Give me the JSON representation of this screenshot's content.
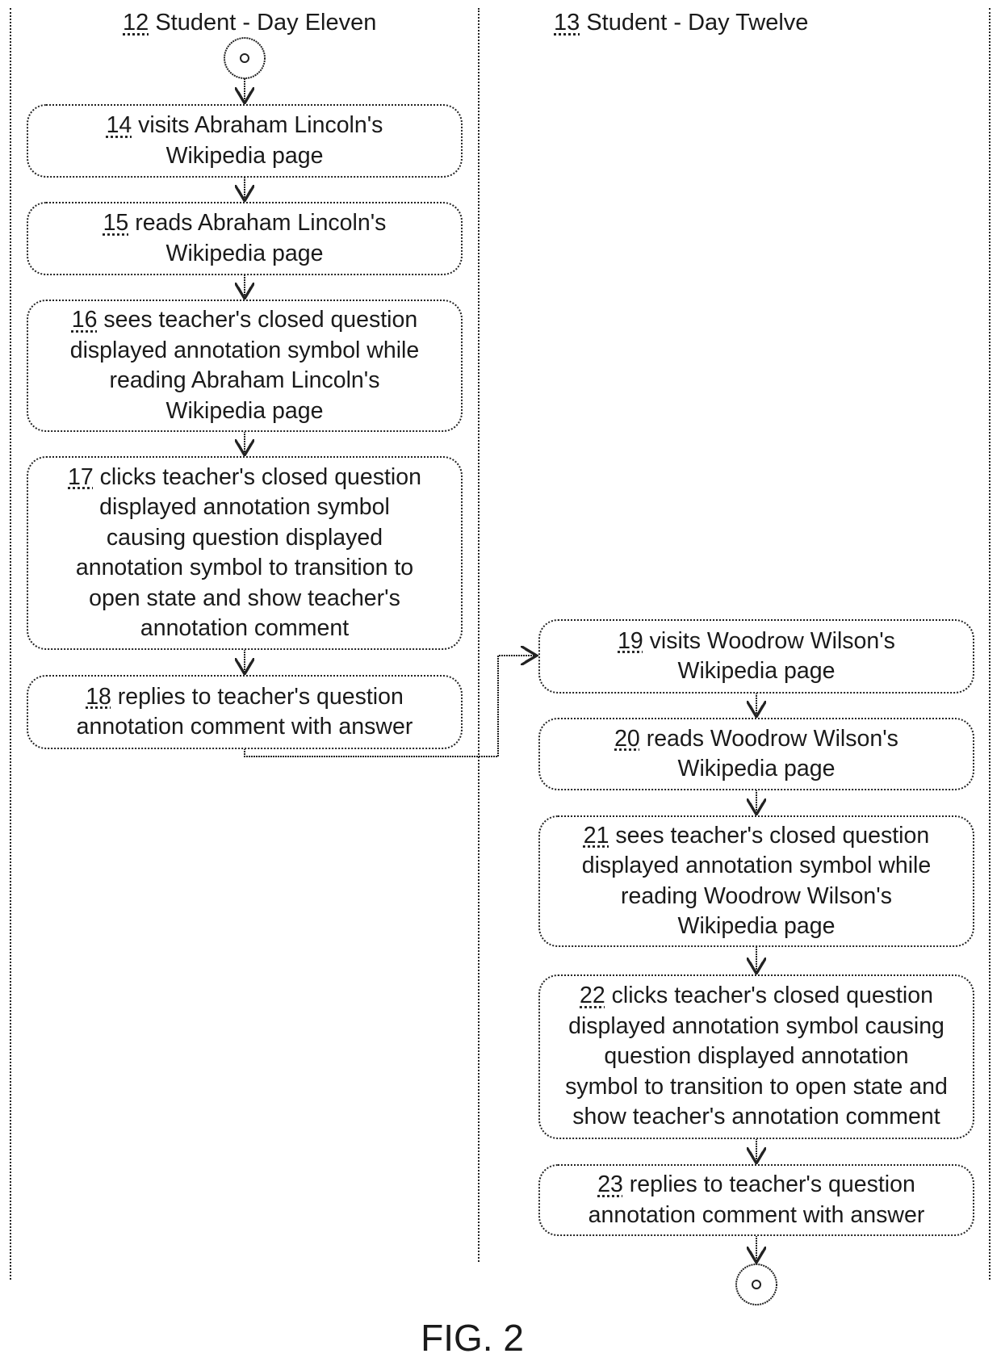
{
  "lanes": [
    {
      "ref": "12",
      "title": "Student - Day Eleven"
    },
    {
      "ref": "13",
      "title": "Student - Day Twelve"
    }
  ],
  "steps": [
    {
      "ref": "14",
      "text": " visits Abraham Lincoln's\nWikipedia page",
      "lane": 0
    },
    {
      "ref": "15",
      "text": " reads Abraham Lincoln's\nWikipedia page",
      "lane": 0
    },
    {
      "ref": "16",
      "text": " sees teacher's closed question\ndisplayed annotation symbol while\nreading Abraham Lincoln's\nWikipedia page",
      "lane": 0
    },
    {
      "ref": "17",
      "text": " clicks teacher's closed question\ndisplayed annotation symbol\ncausing  question displayed\nannotation symbol to transition to\nopen state and show teacher's\nannotation comment",
      "lane": 0
    },
    {
      "ref": "18",
      "text": " replies to teacher's question\nannotation comment with answer",
      "lane": 0
    },
    {
      "ref": "19",
      "text": " visits Woodrow Wilson's\nWikipedia page",
      "lane": 1
    },
    {
      "ref": "20",
      "text": " reads Woodrow Wilson's\nWikipedia page",
      "lane": 1
    },
    {
      "ref": "21",
      "text": " sees teacher's closed question\ndisplayed annotation symbol while\nreading Woodrow Wilson's\nWikipedia page",
      "lane": 1
    },
    {
      "ref": "22",
      "text": " clicks teacher's closed question\ndisplayed annotation symbol causing\nquestion displayed annotation\nsymbol to transition to open state and\nshow teacher's annotation comment",
      "lane": 1
    },
    {
      "ref": "23",
      "text": " replies to teacher's question\nannotation comment with answer",
      "lane": 1
    }
  ],
  "nodes": {
    "start": "initial-node",
    "end": "final-node"
  },
  "figure_label": "FIG. 2"
}
